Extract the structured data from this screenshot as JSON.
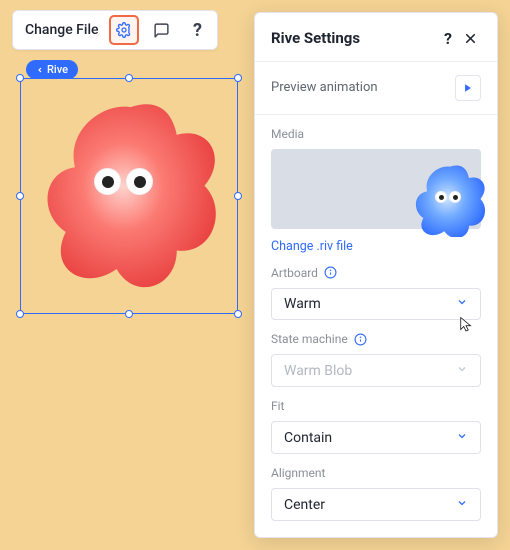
{
  "toolbar": {
    "change_file_label": "Change File"
  },
  "canvas": {
    "tag_label": "Rive"
  },
  "panel": {
    "title": "Rive Settings",
    "preview_label": "Preview animation",
    "media_label": "Media",
    "change_riv_label": "Change .riv file",
    "artboard": {
      "label": "Artboard",
      "value": "Warm"
    },
    "state_machine": {
      "label": "State machine",
      "value": "Warm Blob"
    },
    "fit": {
      "label": "Fit",
      "value": "Contain"
    },
    "alignment": {
      "label": "Alignment",
      "value": "Center"
    }
  },
  "colors": {
    "accent": "#2f6bff",
    "blob_red_a": "#ff8e86",
    "blob_red_b": "#e83f3f",
    "blob_blue_a": "#8fc4ff",
    "blob_blue_b": "#2f6bff"
  }
}
